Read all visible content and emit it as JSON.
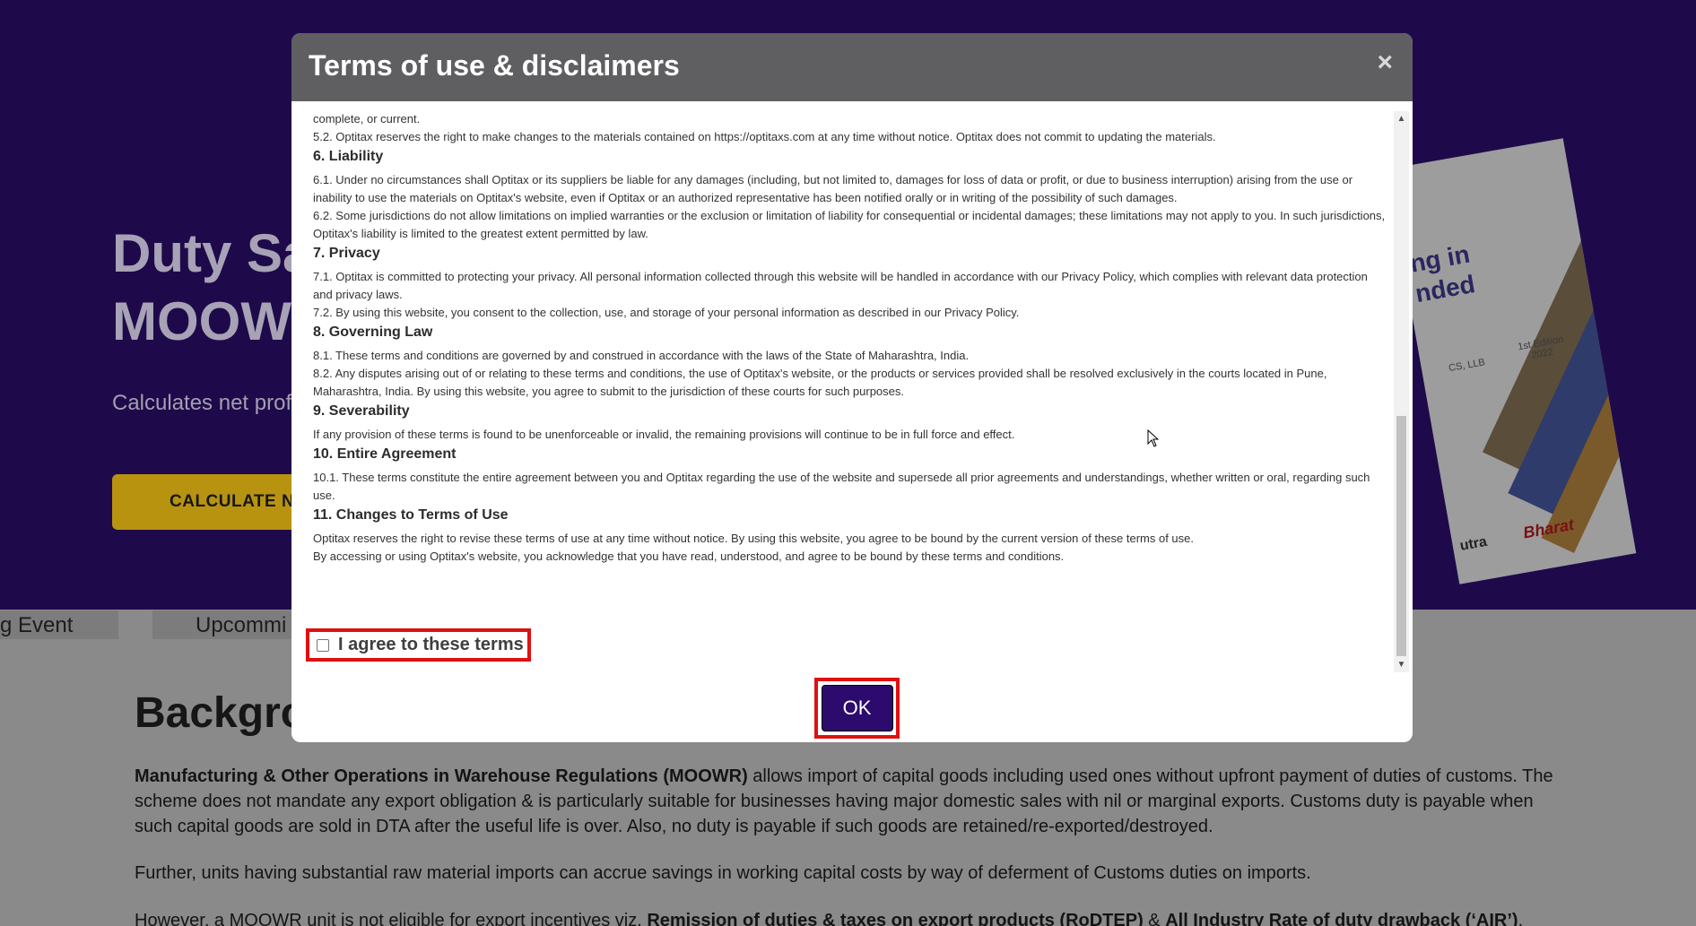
{
  "background": {
    "hero_title": "Duty Sa\nMOOW",
    "hero_subtitle": "Calculates net profi",
    "cta_label": "CALCULATE N",
    "book": {
      "title": "ng in\nnded",
      "author": "CS, LLB",
      "edition": "1st Edition\n2022",
      "brand1": "utra",
      "brand2": "Bharat"
    },
    "tabs": [
      "g Event",
      "Upcommi"
    ],
    "section_heading": "Backgro",
    "paragraphs": [
      {
        "bold": "Manufacturing & Other Operations in Warehouse Regulations (MOOWR)",
        "text": " allows import of capital goods including used ones without upfront payment of duties of customs. The scheme does not mandate any export obligation & is particularly suitable for businesses having major domestic sales with nil or marginal exports. Customs duty is payable when such capital goods are sold in DTA after the useful life is over. Also, no duty is payable if such goods are retained/re-exported/destroyed."
      },
      {
        "text": "Further, units having substantial raw material imports can accrue savings in working capital costs by way of deferment of Customs duties on imports."
      },
      {
        "pre": "However, a MOOWR unit is not eligible for export incentives viz. ",
        "bold1": "Remission of duties & taxes on export products (RoDTEP)",
        "mid": " & ",
        "bold2": "All Industry Rate of duty drawback (‘AIR’)",
        "post": "."
      }
    ]
  },
  "modal": {
    "title": "Terms of use & disclaimers",
    "close_symbol": "×",
    "sections": [
      {
        "paras": [
          "complete, or current.",
          "5.2. Optitax reserves the right to make changes to the materials contained on https://optitaxs.com at any time without notice. Optitax does not commit to updating the materials."
        ]
      },
      {
        "heading": "6. Liability",
        "paras": [
          "6.1. Under no circumstances shall Optitax or its suppliers be liable for any damages (including, but not limited to, damages for loss of data or profit, or due to business interruption) arising from the use or inability to use the materials on Optitax's website, even if Optitax or an authorized representative has been notified orally or in writing of the possibility of such damages.",
          "6.2. Some jurisdictions do not allow limitations on implied warranties or the exclusion or limitation of liability for consequential or incidental damages; these limitations may not apply to you. In such jurisdictions, Optitax's liability is limited to the greatest extent permitted by law."
        ]
      },
      {
        "heading": "7. Privacy",
        "paras": [
          "7.1. Optitax is committed to protecting your privacy. All personal information collected through this website will be handled in accordance with our Privacy Policy, which complies with relevant data protection and privacy laws.",
          "7.2. By using this website, you consent to the collection, use, and storage of your personal information as described in our Privacy Policy."
        ]
      },
      {
        "heading": "8. Governing Law",
        "paras": [
          "8.1. These terms and conditions are governed by and construed in accordance with the laws of the State of Maharashtra, India.",
          "8.2. Any disputes arising out of or relating to these terms and conditions, the use of Optitax's website, or the products or services provided shall be resolved exclusively in the courts located in Pune, Maharashtra, India. By using this website, you agree to submit to the jurisdiction of these courts for such purposes."
        ]
      },
      {
        "heading": "9. Severability",
        "paras": [
          "If any provision of these terms is found to be unenforceable or invalid, the remaining provisions will continue to be in full force and effect."
        ]
      },
      {
        "heading": "10. Entire Agreement",
        "paras": [
          "10.1. These terms constitute the entire agreement between you and Optitax regarding the use of the website and supersede all prior agreements and understandings, whether written or oral, regarding such use."
        ]
      },
      {
        "heading": "11. Changes to Terms of Use",
        "paras": [
          "Optitax reserves the right to revise these terms of use at any time without notice. By using this website, you agree to be bound by the current version of these terms of use.",
          "By accessing or using Optitax's website, you acknowledge that you have read, understood, and agree to be bound by these terms and conditions."
        ]
      }
    ],
    "agree_label": "I agree to these terms",
    "agree_checked": false,
    "ok_label": "OK"
  },
  "colors": {
    "hero_bg": "#1e0a4a",
    "modal_header": "#5f5f61",
    "ok_button": "#2d0a6e",
    "highlight": "#e01010"
  }
}
